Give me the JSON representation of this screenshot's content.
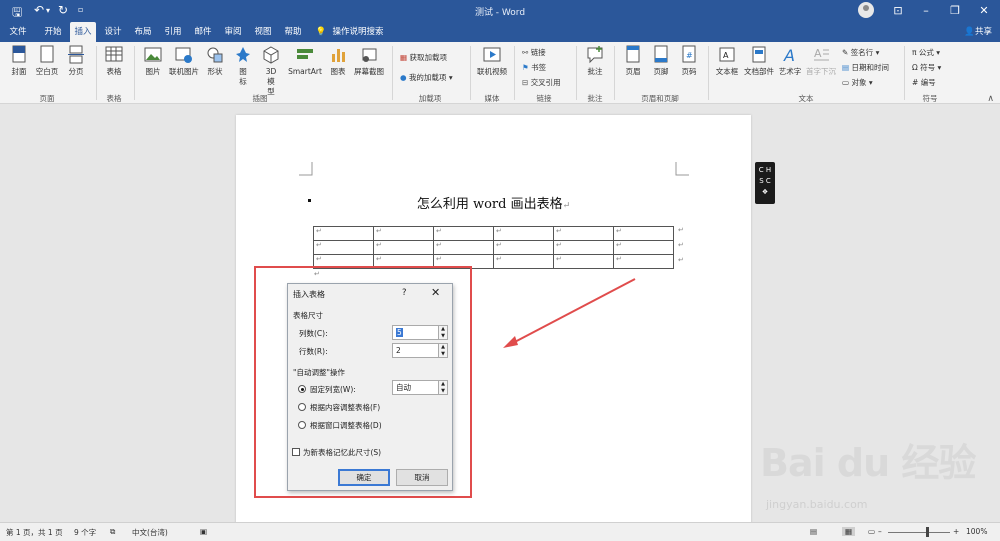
{
  "window": {
    "title": "测试 - Word",
    "share_label": "共享"
  },
  "tabs": [
    "文件",
    "开始",
    "插入",
    "设计",
    "布局",
    "引用",
    "邮件",
    "审阅",
    "视图",
    "帮助",
    "操作说明搜索"
  ],
  "ribbon": {
    "pages_group": {
      "label": "页面",
      "items": [
        "封面",
        "空白页",
        "分页"
      ]
    },
    "tables_group": {
      "label": "表格",
      "items": [
        "表格"
      ]
    },
    "illustrations_group": {
      "label": "插图",
      "items": [
        "图片",
        "联机图片",
        "形状",
        "图标",
        "3D模型",
        "SmartArt",
        "图表",
        "屏幕截图"
      ]
    },
    "addins_group": {
      "label": "加载项",
      "items": [
        "获取加载项",
        "我的加载项"
      ]
    },
    "media_group": {
      "label": "媒体",
      "items": [
        "联机视频"
      ]
    },
    "links_group": {
      "label": "链接",
      "items": [
        "链接",
        "书签",
        "交叉引用"
      ]
    },
    "comments_group": {
      "label": "批注",
      "items": [
        "批注"
      ]
    },
    "header_footer_group": {
      "label": "页眉和页脚",
      "items": [
        "页眉",
        "页脚",
        "页码"
      ]
    },
    "text_group": {
      "label": "文本",
      "items": [
        "文本框",
        "文档部件",
        "艺术字",
        "首字下沉",
        "签名行",
        "日期和时间",
        "对象"
      ]
    },
    "symbols_group": {
      "label": "符号",
      "items": [
        "公式",
        "符号",
        "编号"
      ]
    }
  },
  "document": {
    "heading": "怎么利用 word 画出表格",
    "paragraph_mark": "↵",
    "table": {
      "rows": 3,
      "cols": 6
    }
  },
  "dialog": {
    "title": "插入表格",
    "help": "?",
    "close": "✕",
    "size_section": "表格尺寸",
    "columns_label": "列数(C):",
    "columns_value": "5",
    "rows_label": "行数(R):",
    "rows_value": "2",
    "autofit_section": "\"自动调整\"操作",
    "fixed_width_label": "固定列宽(W):",
    "fixed_width_value": "自动",
    "autofit_contents_label": "根据内容调整表格(F)",
    "autofit_window_label": "根据窗口调整表格(D)",
    "remember_label": "为新表格记忆此尺寸(S)",
    "ok_label": "确定",
    "cancel_label": "取消"
  },
  "ime": {
    "line1": "C H",
    "line2": "S C"
  },
  "status": {
    "page": "第 1 页，共 1 页",
    "words": "9 个字",
    "language": "中文(台湾)",
    "zoom": "100%"
  },
  "watermark": {
    "brand": "Bai du 经验",
    "url": "jingyan.baidu.com"
  },
  "colors": {
    "accent": "#2b579a",
    "highlight": "#e04c4c"
  }
}
